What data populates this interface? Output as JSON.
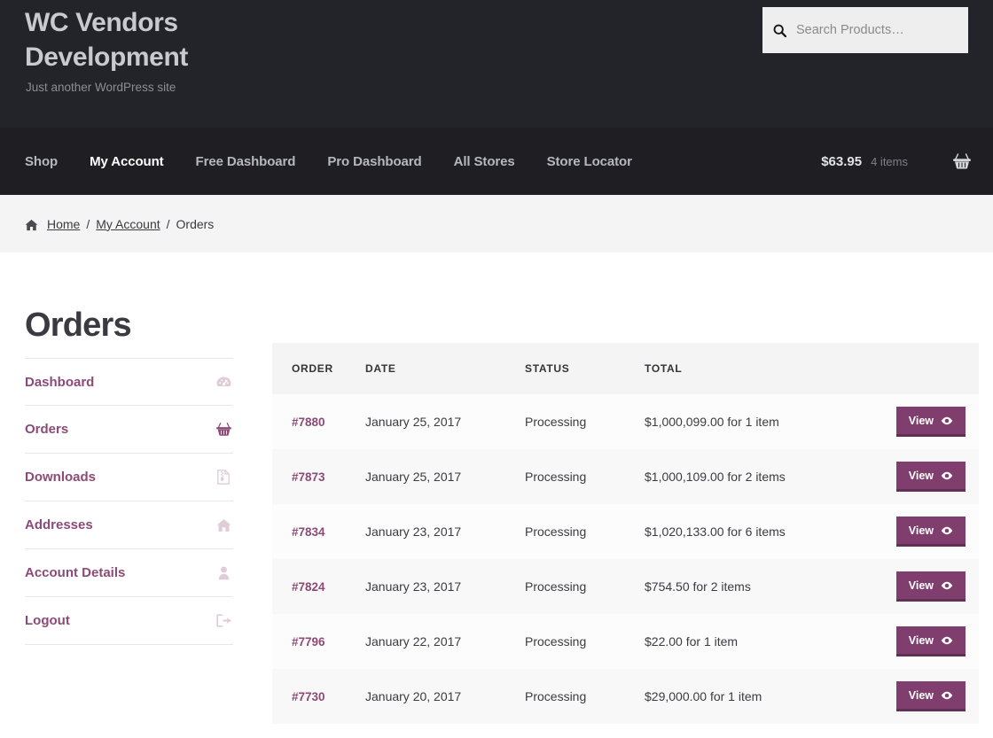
{
  "header": {
    "site_title": "WC Vendors Development",
    "site_description": "Just another WordPress site",
    "search": {
      "placeholder": "Search Products…",
      "value": "",
      "icon": "search-icon"
    }
  },
  "nav": {
    "items": [
      {
        "label": "Shop",
        "current": false
      },
      {
        "label": "My Account",
        "current": true
      },
      {
        "label": "Free Dashboard",
        "current": false
      },
      {
        "label": "Pro Dashboard",
        "current": false
      },
      {
        "label": "All Stores",
        "current": false
      },
      {
        "label": "Store Locator",
        "current": false
      }
    ],
    "cart": {
      "amount": "$63.95",
      "count": "4 items",
      "icon": "shopping-basket-icon"
    }
  },
  "breadcrumb": {
    "home_icon": "home-icon",
    "home": "Home",
    "separator": "/",
    "parent": "My Account",
    "current": "Orders"
  },
  "page": {
    "title": "Orders"
  },
  "account_nav": {
    "items": [
      {
        "label": "Dashboard",
        "icon": "tachometer-icon"
      },
      {
        "label": "Orders",
        "icon": "shopping-basket-icon"
      },
      {
        "label": "Downloads",
        "icon": "file-archive-icon"
      },
      {
        "label": "Addresses",
        "icon": "home-icon"
      },
      {
        "label": "Account Details",
        "icon": "user-icon"
      },
      {
        "label": "Logout",
        "icon": "sign-out-icon"
      }
    ]
  },
  "orders_table": {
    "columns": [
      "ORDER",
      "DATE",
      "STATUS",
      "TOTAL",
      ""
    ],
    "action_label": "View",
    "action_icon": "eye-icon",
    "rows": [
      {
        "order": "#7880",
        "date": "January 25, 2017",
        "status": "Processing",
        "total": "$1,000,099.00 for 1 item"
      },
      {
        "order": "#7873",
        "date": "January 25, 2017",
        "status": "Processing",
        "total": "$1,000,109.00 for 2 items"
      },
      {
        "order": "#7834",
        "date": "January 23, 2017",
        "status": "Processing",
        "total": "$1,020,133.00 for 6 items"
      },
      {
        "order": "#7824",
        "date": "January 23, 2017",
        "status": "Processing",
        "total": "$754.50 for 2 items"
      },
      {
        "order": "#7796",
        "date": "January 22, 2017",
        "status": "Processing",
        "total": "$22.00 for 1 item"
      },
      {
        "order": "#7730",
        "date": "January 20, 2017",
        "status": "Processing",
        "total": "$29,000.00 for 1 item"
      }
    ]
  },
  "colors": {
    "header_bg": "#23232a",
    "nav_bg": "#1e1e23",
    "accent_purple": "#8c4a76",
    "button_purple": "#7f3e6d",
    "breadcrumb_bg": "#f4f4f4",
    "table_header_bg": "#f4f4f4"
  }
}
